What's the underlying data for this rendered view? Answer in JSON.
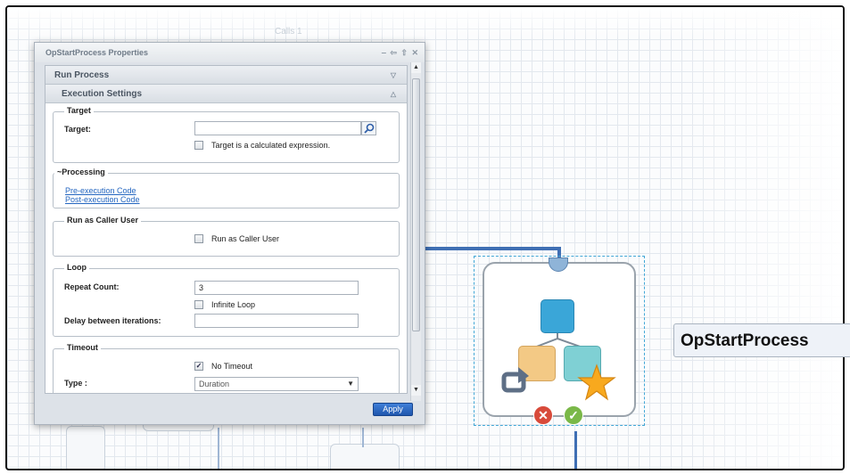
{
  "canvas": {
    "header_label": "Calls 1"
  },
  "dialog": {
    "title": "OpStartProcess Properties",
    "title_controls": "‒ ⇦ ⇧ ✕",
    "sections": {
      "run_process": {
        "label": "Run Process",
        "arrow": "▽"
      },
      "execution_settings": {
        "label": "Execution Settings",
        "arrow": "△"
      }
    },
    "target_group": {
      "legend": "Target",
      "target_label": "Target:",
      "target_value": "",
      "calculated_label": "Target is a calculated expression.",
      "calculated_checked": false
    },
    "processing_group": {
      "legend": "~Processing",
      "pre_link": "Pre-execution Code",
      "post_link": "Post-execution Code"
    },
    "caller_group": {
      "legend": "Run as Caller User",
      "checkbox_label": "Run as Caller User",
      "checked": false
    },
    "loop_group": {
      "legend": "Loop",
      "repeat_label": "Repeat Count:",
      "repeat_value": "3",
      "infinite_label": "Infinite Loop",
      "infinite_checked": false,
      "delay_label": "Delay between iterations:",
      "delay_value": ""
    },
    "timeout_group": {
      "legend": "Timeout",
      "no_timeout_label": "No Timeout",
      "no_timeout_checked": true,
      "no_timeout_mark": "✓",
      "type_label": "Type :",
      "type_value": "Duration"
    },
    "apply_label": "Apply"
  },
  "node": {
    "name": "OpStartProcess",
    "error_symbol": "✕",
    "success_symbol": "✓",
    "colors": {
      "blue": "#3aa6d8",
      "orange": "#f3c985",
      "teal": "#7fd0d4",
      "star": "#f8a91e",
      "error": "#d84a3a",
      "success": "#7ab848"
    }
  }
}
